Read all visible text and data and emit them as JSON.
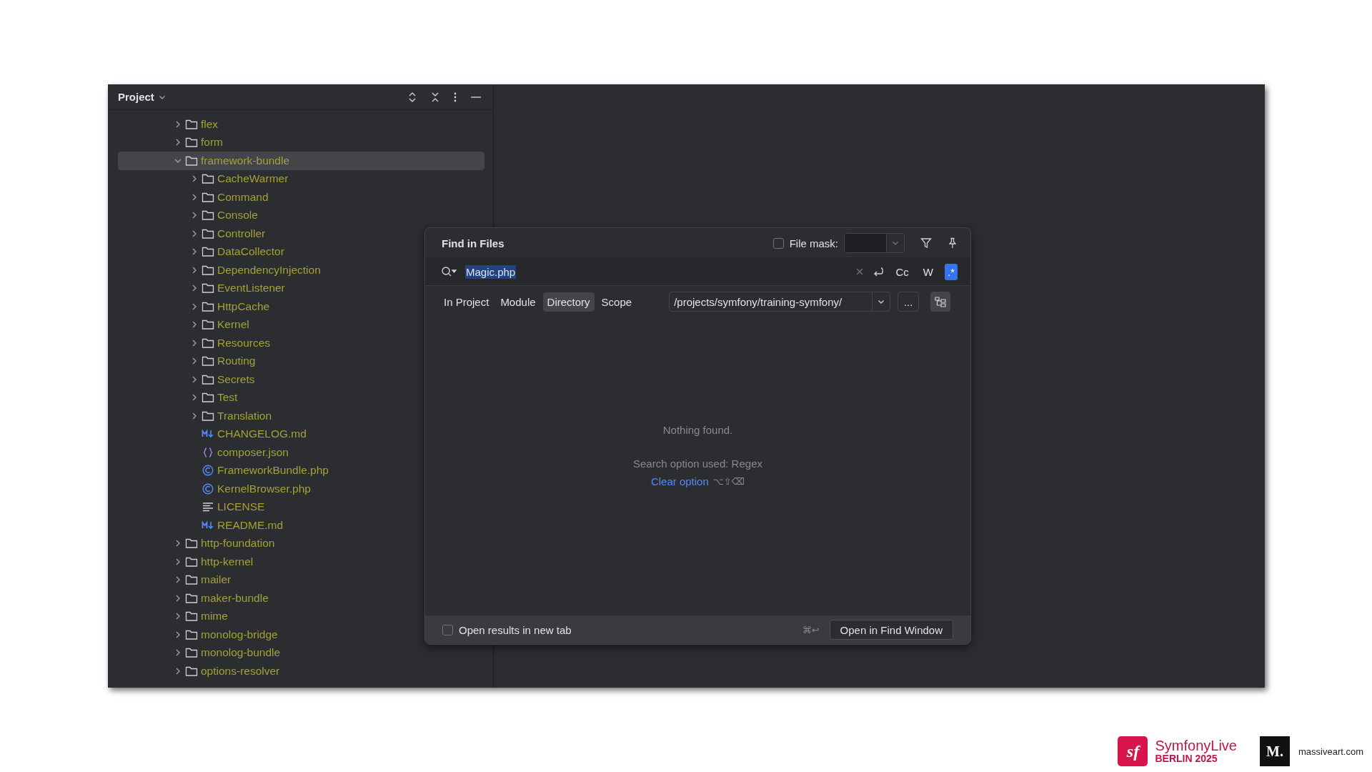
{
  "project_panel": {
    "title": "Project",
    "tree": [
      {
        "name": "flex",
        "kind": "folder",
        "expanded": false,
        "selected": false
      },
      {
        "name": "form",
        "kind": "folder",
        "expanded": false,
        "selected": false
      },
      {
        "name": "framework-bundle",
        "kind": "folder",
        "expanded": true,
        "selected": true,
        "children": [
          {
            "name": "CacheWarmer",
            "kind": "folder",
            "expanded": false,
            "selected": false
          },
          {
            "name": "Command",
            "kind": "folder",
            "expanded": false,
            "selected": false
          },
          {
            "name": "Console",
            "kind": "folder",
            "expanded": false,
            "selected": false
          },
          {
            "name": "Controller",
            "kind": "folder",
            "expanded": false,
            "selected": false
          },
          {
            "name": "DataCollector",
            "kind": "folder",
            "expanded": false,
            "selected": false
          },
          {
            "name": "DependencyInjection",
            "kind": "folder",
            "expanded": false,
            "selected": false
          },
          {
            "name": "EventListener",
            "kind": "folder",
            "expanded": false,
            "selected": false
          },
          {
            "name": "HttpCache",
            "kind": "folder",
            "expanded": false,
            "selected": false
          },
          {
            "name": "Kernel",
            "kind": "folder",
            "expanded": false,
            "selected": false
          },
          {
            "name": "Resources",
            "kind": "folder",
            "expanded": false,
            "selected": false
          },
          {
            "name": "Routing",
            "kind": "folder",
            "expanded": false,
            "selected": false
          },
          {
            "name": "Secrets",
            "kind": "folder",
            "expanded": false,
            "selected": false
          },
          {
            "name": "Test",
            "kind": "folder",
            "expanded": false,
            "selected": false
          },
          {
            "name": "Translation",
            "kind": "folder",
            "expanded": false,
            "selected": false
          },
          {
            "name": "CHANGELOG.md",
            "kind": "markdown",
            "selected": false
          },
          {
            "name": "composer.json",
            "kind": "json",
            "selected": false
          },
          {
            "name": "FrameworkBundle.php",
            "kind": "class",
            "selected": false
          },
          {
            "name": "KernelBrowser.php",
            "kind": "class",
            "selected": false
          },
          {
            "name": "LICENSE",
            "kind": "text",
            "selected": false
          },
          {
            "name": "README.md",
            "kind": "markdown",
            "selected": false
          }
        ]
      },
      {
        "name": "http-foundation",
        "kind": "folder",
        "expanded": false,
        "selected": false
      },
      {
        "name": "http-kernel",
        "kind": "folder",
        "expanded": false,
        "selected": false
      },
      {
        "name": "mailer",
        "kind": "folder",
        "expanded": false,
        "selected": false
      },
      {
        "name": "maker-bundle",
        "kind": "folder",
        "expanded": false,
        "selected": false
      },
      {
        "name": "mime",
        "kind": "folder",
        "expanded": false,
        "selected": false
      },
      {
        "name": "monolog-bridge",
        "kind": "folder",
        "expanded": false,
        "selected": false
      },
      {
        "name": "monolog-bundle",
        "kind": "folder",
        "expanded": false,
        "selected": false
      },
      {
        "name": "options-resolver",
        "kind": "folder",
        "expanded": false,
        "selected": false
      }
    ]
  },
  "find_dialog": {
    "title": "Find in Files",
    "file_mask": {
      "label": "File mask:",
      "checked": false
    },
    "search": {
      "value": "Magic.php"
    },
    "options": [
      {
        "label": "Cc",
        "selected": false
      },
      {
        "label": "W",
        "selected": false
      },
      {
        "label": ".*",
        "selected": true
      }
    ],
    "scope_tabs": [
      {
        "label": "In Project",
        "selected": false
      },
      {
        "label": "Module",
        "selected": false
      },
      {
        "label": "Directory",
        "selected": true
      },
      {
        "label": "Scope",
        "selected": false
      }
    ],
    "directory": {
      "value": "/projects/symfony/training-symfony/"
    },
    "browse_button": "...",
    "view_toggle": {
      "selected": true
    },
    "message": "Nothing found.",
    "option_note": "Search option used: Regex",
    "clear_link": "Clear option",
    "clear_shortcut": "⌥⇧⌫",
    "new_tab": {
      "label": "Open results in new tab",
      "checked": false
    },
    "open_shortcut": "⌘↩",
    "open_button": "Open in Find Window"
  },
  "branding": {
    "symfony_mark": "sf",
    "event_name": "SymfonyLive",
    "event_place": "BERLIN 2025",
    "sponsor_mark": "M.",
    "sponsor_site": "massiveart.com"
  }
}
